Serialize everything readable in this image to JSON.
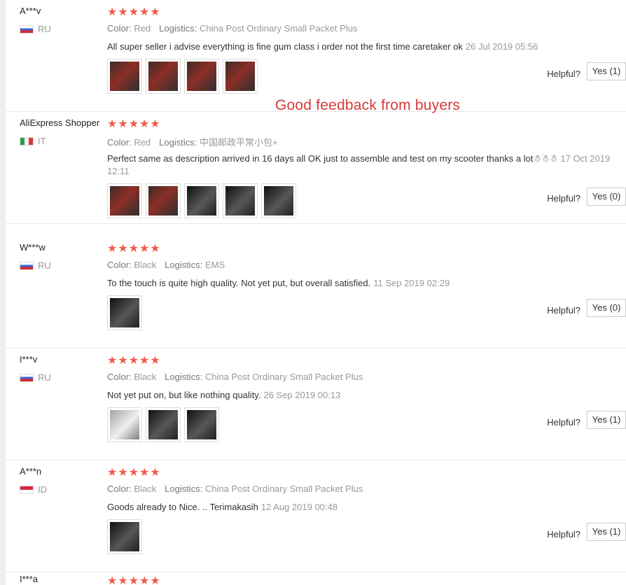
{
  "labels": {
    "color": "Color:",
    "logistics": "Logistics:",
    "helpful": "Helpful?"
  },
  "caption": "Good feedback from buyers",
  "reviews": [
    {
      "name": "A***v",
      "country": "RU",
      "stars": "★★★★★",
      "color": "Red",
      "logistics": "China Post Ordinary Small Packet Plus",
      "text": "All super seller i advise everything is fine gum class i order not the first time caretaker ok",
      "date": "26 Jul 2019 05:56",
      "helpful_button": "Yes (1)"
    },
    {
      "name": "AliExpress Shopper",
      "country": "IT",
      "stars": "★★★★★",
      "color": "Red",
      "logistics": "中国邮政平常小包+",
      "text": "Perfect same as description arrived in 16 days all OK just to assemble and test on my scooter thanks a lot☃☃☃",
      "date": "17 Oct 2019 12:11",
      "helpful_button": "Yes (0)"
    },
    {
      "name": "W***w",
      "country": "RU",
      "stars": "★★★★★",
      "color": "Black",
      "logistics": "EMS",
      "text": "To the touch is quite high quality. Not yet put, but overall satisfied.",
      "date": "11 Sep 2019 02:29",
      "helpful_button": "Yes (0)"
    },
    {
      "name": "I***v",
      "country": "RU",
      "stars": "★★★★★",
      "color": "Black",
      "logistics": "China Post Ordinary Small Packet Plus",
      "text": "Not yet put on, but like nothing quality.",
      "date": "26 Sep 2019 00:13",
      "helpful_button": "Yes (1)"
    },
    {
      "name": "A***n",
      "country": "ID",
      "stars": "★★★★★",
      "color": "Black",
      "logistics": "China Post Ordinary Small Packet Plus",
      "text": "Goods already to Nice. .. Terimakasih",
      "date": "12 Aug 2019 00:48",
      "helpful_button": "Yes (1)"
    }
  ],
  "next_review": {
    "name": "I***a",
    "stars": "★★★★★"
  }
}
